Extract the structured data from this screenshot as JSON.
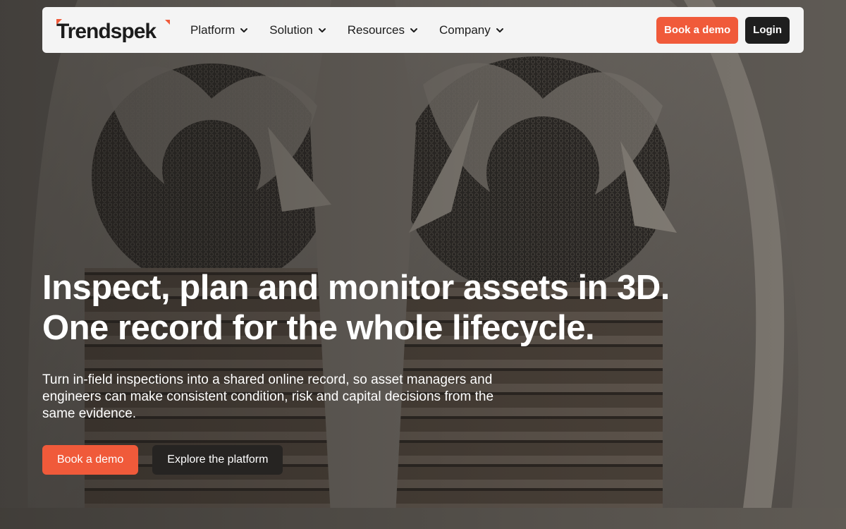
{
  "brand": {
    "name": "Trendspek",
    "accent_color": "#f05a3a",
    "dark_color": "#1e1e1e"
  },
  "nav": {
    "items": [
      {
        "label": "Platform",
        "icon": "chevron-down-icon"
      },
      {
        "label": "Solution",
        "icon": "chevron-down-icon"
      },
      {
        "label": "Resources",
        "icon": "chevron-down-icon"
      },
      {
        "label": "Company",
        "icon": "chevron-down-icon"
      }
    ],
    "book_demo_label": "Book a demo",
    "login_label": "Login"
  },
  "hero": {
    "title_line1": "Inspect, plan and monitor assets in 3D.",
    "title_line2": "One record for the whole lifecycle.",
    "subtitle": "Turn in-field inspections into a shared online record, so asset managers and engineers can make consistent condition, risk and capital decisions from the same evidence.",
    "primary_cta": "Book a demo",
    "secondary_cta": "Explore the platform"
  }
}
